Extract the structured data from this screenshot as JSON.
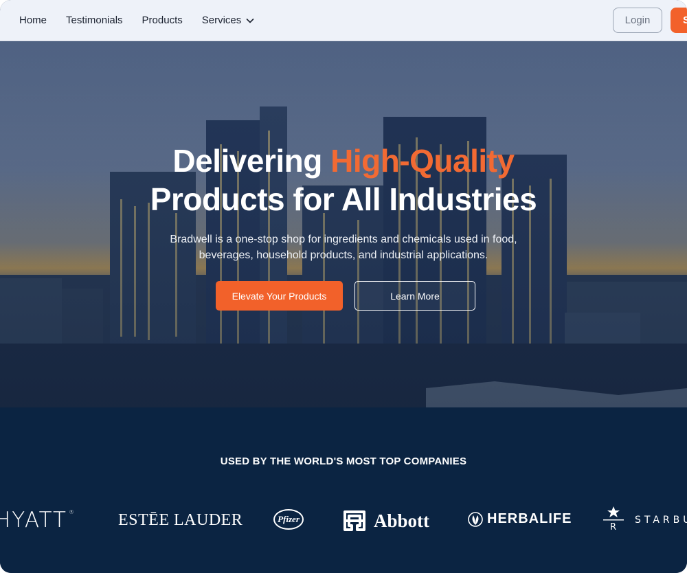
{
  "nav": {
    "links": [
      "Home",
      "Testimonials",
      "Products",
      "Services"
    ],
    "login_label": "Login",
    "signup_label": "S"
  },
  "hero": {
    "headline_part1": "Delivering ",
    "headline_accent": "High-Quality",
    "headline_line2": "Products for All Industries",
    "subtitle": "Bradwell is a one-stop shop for ingredients and chemicals used in food, beverages, household products, and industrial applications.",
    "primary_cta": "Elevate Your Products",
    "secondary_cta": "Learn More"
  },
  "companies": {
    "title": "USED BY THE WORLD'S MOST TOP COMPANIES",
    "logos": [
      "HYATT",
      "ESTĒE LAUDER",
      "Pfizer",
      "Abbott",
      "HERBALIFE",
      "STARBU"
    ],
    "hyatt_reg": "®",
    "starbucks_r": "R"
  },
  "colors": {
    "accent": "#f2612a",
    "navy": "#0b2442",
    "nav_bg": "#eef2f9"
  },
  "icons": {
    "services_dropdown": "chevron-down-icon"
  }
}
